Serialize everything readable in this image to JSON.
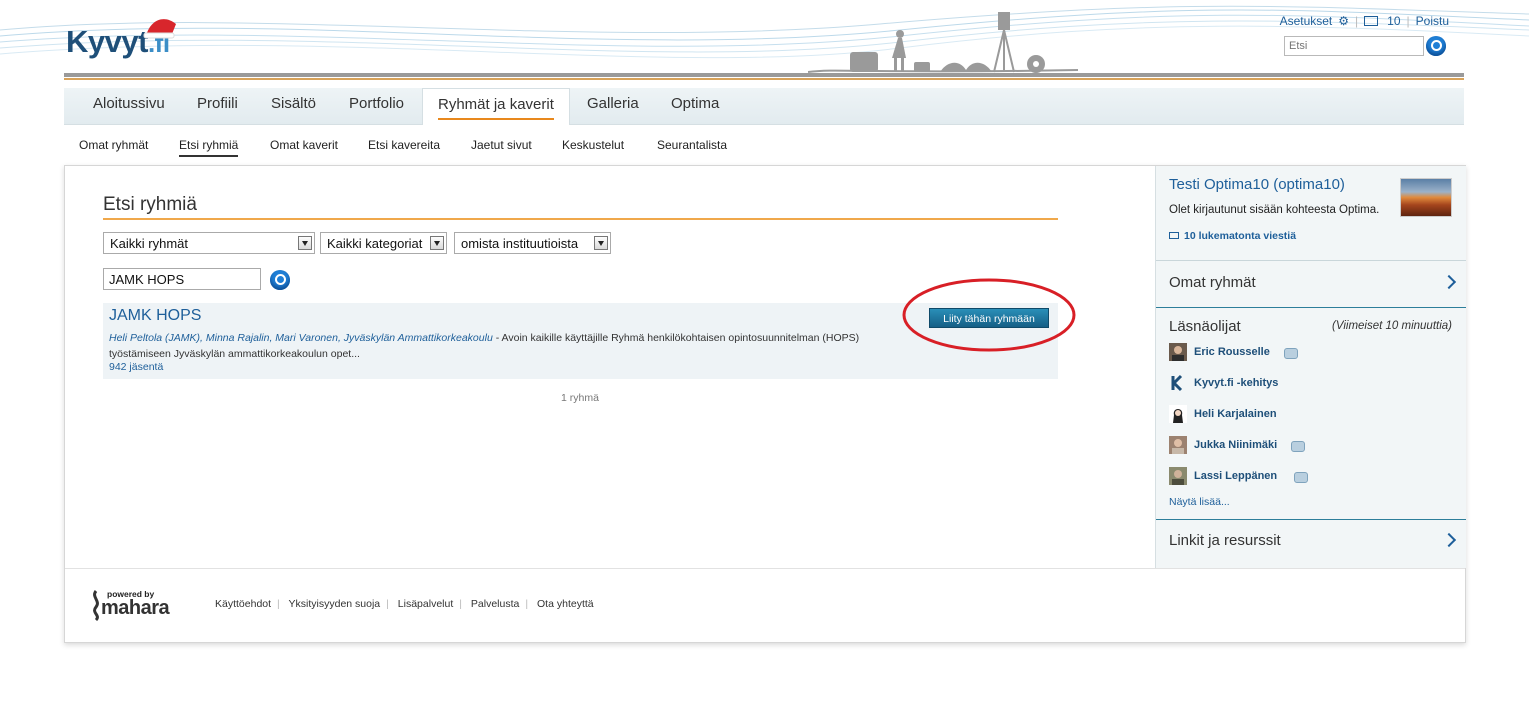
{
  "header": {
    "logo_main": "Kyvyt",
    "logo_tld": ".fi",
    "settings": "Asetukset",
    "inbox_count": "10",
    "logout": "Poistu",
    "search_placeholder": "Etsi"
  },
  "main_nav": [
    {
      "label": "Aloitussivu",
      "active": false
    },
    {
      "label": "Profiili",
      "active": false
    },
    {
      "label": "Sisältö",
      "active": false
    },
    {
      "label": "Portfolio",
      "active": false
    },
    {
      "label": "Ryhmät ja kaverit",
      "active": true
    },
    {
      "label": "Galleria",
      "active": false
    },
    {
      "label": "Optima",
      "active": false
    }
  ],
  "sub_nav": [
    {
      "label": "Omat ryhmät",
      "active": false
    },
    {
      "label": "Etsi ryhmiä",
      "active": true
    },
    {
      "label": "Omat kaverit",
      "active": false
    },
    {
      "label": "Etsi kavereita",
      "active": false
    },
    {
      "label": "Jaetut sivut",
      "active": false
    },
    {
      "label": "Keskustelut",
      "active": false
    },
    {
      "label": "Seurantalista",
      "active": false
    }
  ],
  "page": {
    "title": "Etsi ryhmiä",
    "filter_groups": "Kaikki ryhmät",
    "filter_categories": "Kaikki kategoriat",
    "filter_institution": "omista instituutioista",
    "query": "JAMK HOPS",
    "result": {
      "title": "JAMK HOPS",
      "admins": "Heli Peltola (JAMK), Minna Rajalin, Mari Varonen, Jyväskylän Ammattikorkeakoulu",
      "description": " - Avoin kaikille käyttäjille Ryhmä henkilökohtaisen opintosuunnitelman (HOPS) työstämiseen Jyväskylän ammattikorkeakoulun opet...",
      "members": "942 jäsentä",
      "join_label": "Liity tähän ryhmään"
    },
    "count": "1 ryhmä"
  },
  "sidebar": {
    "user_name": "Testi Optima10 (optima10)",
    "logged_in": "Olet kirjautunut sisään kohteesta Optima.",
    "unread": "10 lukematonta viestiä",
    "my_groups": "Omat ryhmät",
    "online_title": "Läsnäolijat",
    "online_hint": "(Viimeiset 10 minuuttia)",
    "online_users": [
      {
        "name": "Eric Rousselle",
        "chat": true
      },
      {
        "name": "Kyvyt.fi -kehitys",
        "chat": false
      },
      {
        "name": "Heli Karjalainen",
        "chat": false
      },
      {
        "name": "Jukka Niinimäki",
        "chat": true
      },
      {
        "name": "Lassi Leppänen",
        "chat": true
      }
    ],
    "show_more": "Näytä lisää...",
    "links": "Linkit ja resurssit"
  },
  "footer": {
    "powered_by": "powered by",
    "brand": "mahara",
    "links": [
      "Käyttöehdot",
      "Yksityisyyden suoja",
      "Lisäpalvelut",
      "Palvelusta",
      "Ota yhteyttä"
    ]
  },
  "colors": {
    "brand_blue": "#1e5f9a",
    "accent_orange": "#f0a84b",
    "highlight_red": "#d81f26"
  }
}
